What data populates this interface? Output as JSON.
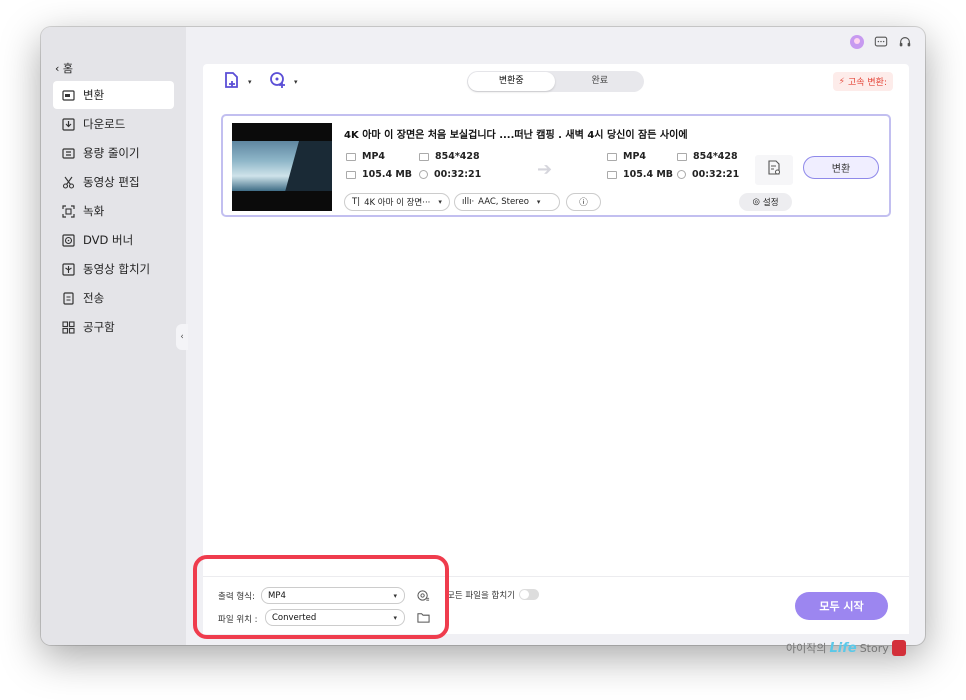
{
  "sidebar": {
    "home": "홈",
    "items": [
      {
        "label": "변환",
        "icon": "convert-icon",
        "active": true
      },
      {
        "label": "다운로드",
        "icon": "download-icon"
      },
      {
        "label": "용량 줄이기",
        "icon": "compress-icon"
      },
      {
        "label": "동영상 편집",
        "icon": "scissors-icon"
      },
      {
        "label": "녹화",
        "icon": "record-icon"
      },
      {
        "label": "DVD 버너",
        "icon": "disc-icon"
      },
      {
        "label": "동영상 합치기",
        "icon": "merge-icon"
      },
      {
        "label": "전송",
        "icon": "transfer-icon"
      },
      {
        "label": "공구함",
        "icon": "toolbox-icon"
      }
    ]
  },
  "tabs": {
    "converting": "변환중",
    "done": "완료"
  },
  "fast_convert": "고속 변환:",
  "file": {
    "title": "4K 아마 이 장면은 처음 보실겁니다 ....떠난 캠핑 . 새벽 4시 당신이 잠든 사이에",
    "source": {
      "format": "MP4",
      "resolution": "854*428",
      "size": "105.4 MB",
      "duration": "00:32:21"
    },
    "target": {
      "format": "MP4",
      "resolution": "854*428",
      "size": "105.4 MB",
      "duration": "00:32:21"
    },
    "subtitle_select": "4K 아마 이 장면···",
    "audio_select": "AAC, Stereo",
    "settings_label": "설정",
    "convert_label": "변환"
  },
  "bottom": {
    "output_format_label": "출력 형식:",
    "output_format_value": "MP4",
    "file_location_label": "파일 위치 :",
    "file_location_value": "Converted",
    "merge_label": "모든 파일을 합치기",
    "merge_enabled": false,
    "start_all": "모두 시작"
  },
  "colors": {
    "accent": "#9c86f0",
    "highlight": "#ef3c4d",
    "fast": "#e5493c"
  }
}
